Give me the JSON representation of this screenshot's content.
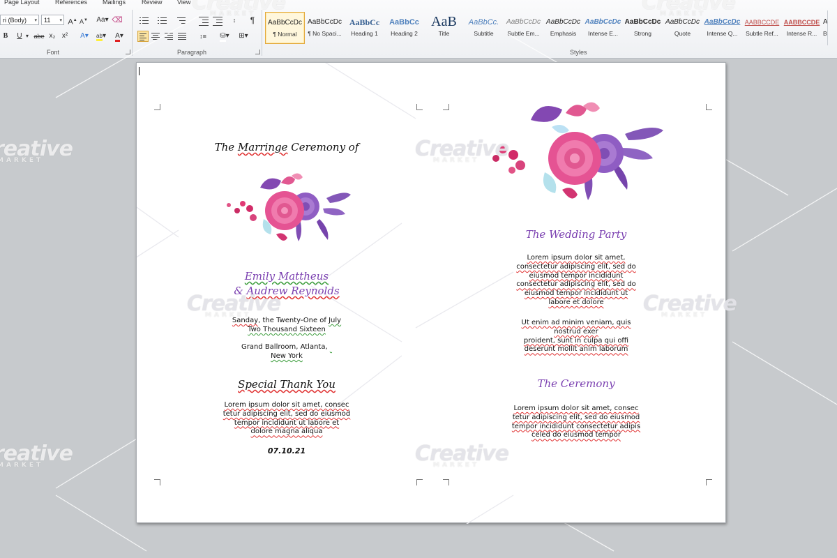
{
  "ribbon": {
    "tabs": [
      "Page Layout",
      "References",
      "Mailings",
      "Review",
      "View"
    ],
    "font_name": "ri (Body)",
    "font_size": "11",
    "group_labels": {
      "font": "Font",
      "paragraph": "Paragraph",
      "styles": "Styles"
    },
    "glyphs": {
      "bold": "B",
      "underline": "U",
      "strike": "abe",
      "subscript": "x₂",
      "superscript": "x²",
      "clear": "Aa",
      "grow": "A",
      "shrink": "A"
    },
    "styles": [
      {
        "sample": "AaBbCcDc",
        "name": "¶ Normal"
      },
      {
        "sample": "AaBbCcDc",
        "name": "¶ No Spaci..."
      },
      {
        "sample": "AaBbCc",
        "name": "Heading 1"
      },
      {
        "sample": "AaBbCc",
        "name": "Heading 2"
      },
      {
        "sample": "AaB",
        "name": "Title"
      },
      {
        "sample": "AaBbCc.",
        "name": "Subtitle"
      },
      {
        "sample": "AaBbCcDc",
        "name": "Subtle Em..."
      },
      {
        "sample": "AaBbCcDc",
        "name": "Emphasis"
      },
      {
        "sample": "AaBbCcDc",
        "name": "Intense E..."
      },
      {
        "sample": "AaBbCcDc",
        "name": "Strong"
      },
      {
        "sample": "AaBbCcDc",
        "name": "Quote"
      },
      {
        "sample": "AaBbCcDc",
        "name": "Intense Q..."
      },
      {
        "sample": "AABBCCDE",
        "name": "Subtle Ref..."
      },
      {
        "sample": "AABBCCDE",
        "name": "Intense R..."
      },
      {
        "sample": "AaBbCcDc",
        "name": "Book Title"
      }
    ]
  },
  "left_panel": {
    "heading_prefix": "The ",
    "heading_word": "Marringe",
    "heading_suffix": " Ceremony of",
    "name1": "Emily Mattheus",
    "name2_amp": "& ",
    "name2": "Audrew Reynolds",
    "date_line1_a": "Sanday",
    "date_line1_b": ", the Twenty-One of ",
    "date_line1_c": "July",
    "date_line2": "Two Thousand Sixteen",
    "venue_line1": "Grand Ballroom, Atlanta, ",
    "venue_line2": "New York",
    "thanks_title": "Special Thank You",
    "thanks_lines": [
      "Lorem ipsum dolor sit amet, consec",
      "tetur adipiscing elit, sed do eiusmod",
      "tempor incididunt ut labore et",
      "dolore magna aliqua"
    ],
    "date": "07.10.21"
  },
  "right_panel": {
    "party_title": "The Wedding Party",
    "party_lines": [
      "Lorem ipsum dolor sit amet,",
      "consectetur adipiscing elit, sed do",
      "eiusmod tempor incididunt",
      "consectetur adipiscing elit, sed do",
      "eiusmod tempor incididunt ut",
      "labore et dolore"
    ],
    "party_lines2": [
      "Ut enim ad minim veniam, quis",
      "nostrud exer",
      "proident, sunt in culpa qui offi",
      "deserunt mollit anim laborum"
    ],
    "ceremony_title": "The Ceremony",
    "ceremony_lines": [
      "Lorem ipsum dolor sit amet, consec",
      "tetur adipiscing elit, sed do eiusmod",
      "tempor incididunt consectetur adipis",
      "celed do eiusmod tempor"
    ]
  },
  "watermark": {
    "main": "Creative",
    "sub": "MARKET"
  },
  "colors": {
    "accent_purple": "#7a3fb0",
    "rose": "#e04a8a",
    "violet": "#8a55c0"
  }
}
